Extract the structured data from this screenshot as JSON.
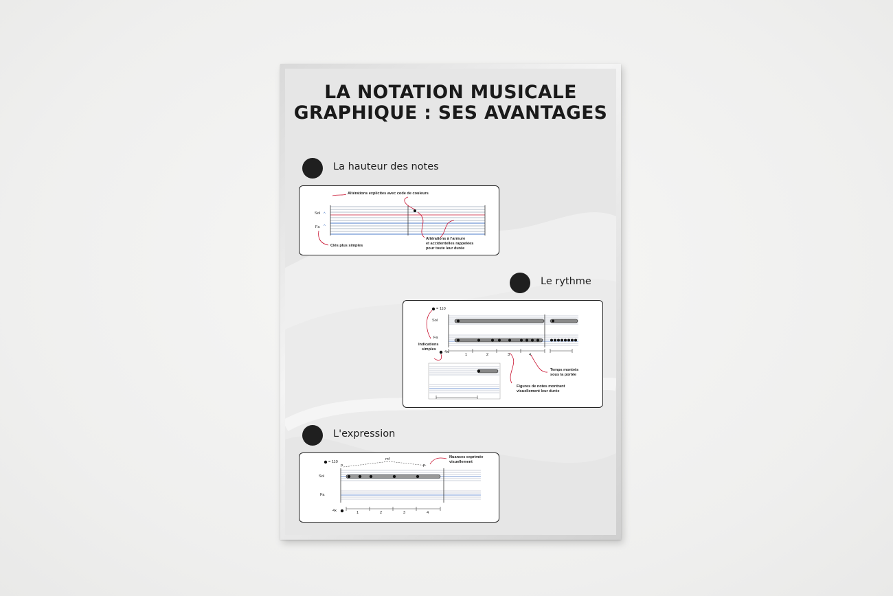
{
  "poster": {
    "title_line1": "LA NOTATION MUSICALE",
    "title_line2": "GRAPHIQUE : SES AVANTAGES"
  },
  "sections": {
    "pitch": {
      "title": "La hauteur des notes",
      "annot_alterations_colors": "Altérations explicites avec code de couleurs",
      "clef_sol": "Sol",
      "clef_fa": "Fa",
      "annot_clefs": "Clés plus simples",
      "annot_armure_1": "Altérations à l'armure",
      "annot_armure_2": "et accidentelles rappelées",
      "annot_armure_3": "pour toute leur durée"
    },
    "rhythm": {
      "title": "Le rythme",
      "tempo": "= 110",
      "clef_sol": "Sol",
      "clef_fa": "Fa",
      "meter": "4x",
      "annot_indications_1": "Indications",
      "annot_indications_2": "simples",
      "beats": [
        "1",
        "2",
        "3",
        "4"
      ],
      "annot_temps_1": "Temps montrés",
      "annot_temps_2": "sous la portée",
      "annot_figures_1": "Figures de notes montrant",
      "annot_figures_2": "visuellement leur durée"
    },
    "expression": {
      "title": "L'expression",
      "tempo": "= 110",
      "dyn_mf": "mf",
      "dyn_p_left": "p",
      "dyn_p_right": "p",
      "annot_nuances_1": "Nuances exprimée",
      "annot_nuances_2": "visuellement",
      "clef_sol": "Sol",
      "clef_fa": "Fa",
      "meter": "4x",
      "beats": [
        "1",
        "2",
        "3",
        "4"
      ]
    }
  },
  "colors": {
    "accent_red": "#c8102e",
    "staff_blue": "#4a78c8",
    "ink": "#1f1f1f"
  }
}
